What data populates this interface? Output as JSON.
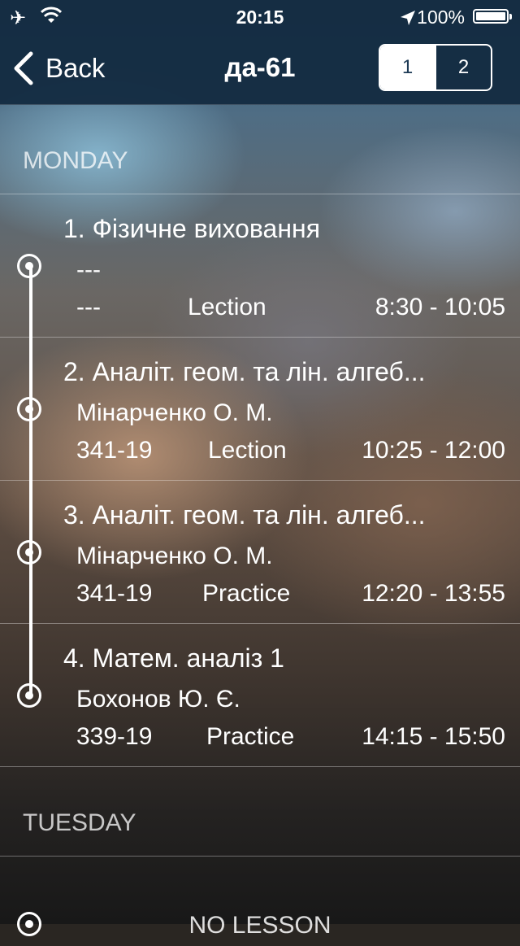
{
  "status_bar": {
    "time": "20:15",
    "battery": "100%",
    "icons": [
      "airplane-icon",
      "wifi-icon",
      "location-arrow-icon",
      "battery-icon"
    ]
  },
  "nav": {
    "back_label": "Back",
    "title": "да-61",
    "segments": [
      "1",
      "2"
    ],
    "selected_segment": "1"
  },
  "days": [
    {
      "name": "MONDAY",
      "lessons": [
        {
          "title": "1. Фізичне виховання",
          "teacher": "---",
          "room": "---",
          "type": "Lection",
          "time": "8:30 - 10:05"
        },
        {
          "title": "2. Аналіт. геом. та лін. алгеб...",
          "teacher": "Мінарченко О. М.",
          "room": "341-19",
          "type": "Lection",
          "time": "10:25 - 12:00"
        },
        {
          "title": "3. Аналіт. геом. та лін. алгеб...",
          "teacher": "Мінарченко О. М.",
          "room": "341-19",
          "type": "Practice",
          "time": "12:20 - 13:55"
        },
        {
          "title": "4. Матем. аналіз 1",
          "teacher": "Бохонов Ю. Є.",
          "room": "339-19",
          "type": "Practice",
          "time": "14:15 - 15:50"
        }
      ]
    },
    {
      "name": "TUESDAY",
      "lessons": [],
      "empty_label": "NO LESSON"
    }
  ],
  "colors": {
    "navbar": "#142c42",
    "accent": "#ffffff"
  }
}
